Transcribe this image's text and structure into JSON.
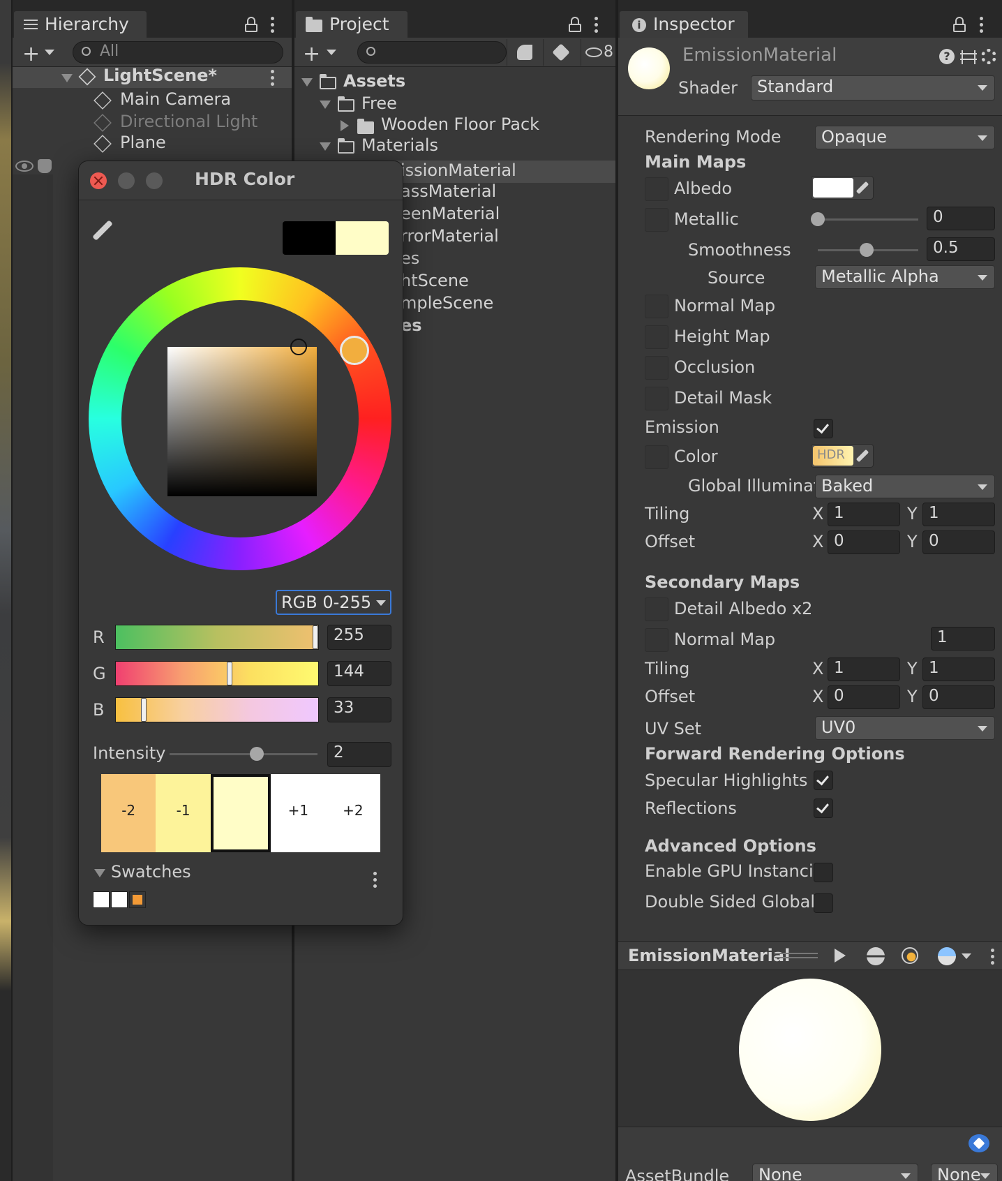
{
  "hierarchy": {
    "tab_label": "Hierarchy",
    "search_placeholder": "All",
    "scene_name": "LightScene*",
    "items": [
      "Main Camera",
      "Directional Light",
      "Plane"
    ]
  },
  "project": {
    "tab_label": "Project",
    "hidden_count": "8",
    "tree": {
      "assets": "Assets",
      "free": "Free",
      "wooden_floor_pack": "Wooden Floor Pack",
      "materials": "Materials",
      "partial_items": [
        "issionMaterial",
        "assMaterial",
        "eenMaterial",
        "rrorMaterial",
        "es",
        "htScene",
        "mpleScene",
        "es"
      ]
    }
  },
  "inspector": {
    "tab_label": "Inspector",
    "material_name": "EmissionMaterial",
    "shader_label": "Shader",
    "shader_value": "Standard",
    "rendering_mode_label": "Rendering Mode",
    "rendering_mode_value": "Opaque",
    "main_maps_header": "Main Maps",
    "albedo_label": "Albedo",
    "metallic_label": "Metallic",
    "metallic_value": "0",
    "smoothness_label": "Smoothness",
    "smoothness_value": "0.5",
    "source_label": "Source",
    "source_value": "Metallic Alpha",
    "normal_map_label": "Normal Map",
    "height_map_label": "Height Map",
    "occlusion_label": "Occlusion",
    "detail_mask_label": "Detail Mask",
    "emission_label": "Emission",
    "emission_enabled": true,
    "color_label": "Color",
    "hdr_badge": "HDR",
    "gi_label": "Global Illuminati",
    "gi_value": "Baked",
    "tiling_label": "Tiling",
    "offset_label": "Offset",
    "x_label": "X",
    "y_label": "Y",
    "tiling_x": "1",
    "tiling_y": "1",
    "offset_x": "0",
    "offset_y": "0",
    "secondary_maps_header": "Secondary Maps",
    "detail_albedo_label": "Detail Albedo x2",
    "normal_map_2_label": "Normal Map",
    "normal_map_2_value": "1",
    "tiling2_x": "1",
    "tiling2_y": "1",
    "offset2_x": "0",
    "offset2_y": "0",
    "uv_set_label": "UV Set",
    "uv_set_value": "UV0",
    "forward_header": "Forward Rendering Options",
    "specular_label": "Specular Highlights",
    "specular_enabled": true,
    "reflections_label": "Reflections",
    "reflections_enabled": true,
    "advanced_header": "Advanced Options",
    "gpu_instancing_label": "Enable GPU Instancir",
    "gpu_instancing_enabled": false,
    "double_sided_label": "Double Sided Global I",
    "double_sided_enabled": false,
    "preview_title": "EmissionMaterial",
    "assetbundle_label": "AssetBundle",
    "assetbundle_value": "None",
    "assetbundle_variant": "None"
  },
  "hdr_color": {
    "title": "HDR Color",
    "mode_value": "RGB 0-255",
    "r_label": "R",
    "g_label": "G",
    "b_label": "B",
    "r_value": "255",
    "g_value": "144",
    "b_value": "33",
    "r_fraction": 1.0,
    "g_fraction": 0.565,
    "b_fraction": 0.129,
    "intensity_label": "Intensity",
    "intensity_value": "2",
    "intensity_fraction": 0.6,
    "stops": [
      "-2",
      "-1",
      "",
      "+1",
      "+2"
    ],
    "stop_colors": [
      "#f8c77a",
      "#fdf39a",
      "#fffdc7",
      "#ffffff",
      "#ffffff"
    ],
    "swatches_label": "Swatches",
    "swatch_colors": [
      "#ffffff",
      "#ffffff",
      "#f39a36"
    ],
    "old_color": "#000000",
    "new_color": "#fffdc7",
    "hue_color": "#f2ae3e"
  },
  "colors": {
    "panel_bg": "#383838",
    "accent_blue": "#3a79d8",
    "close_red": "#ee5a52"
  }
}
